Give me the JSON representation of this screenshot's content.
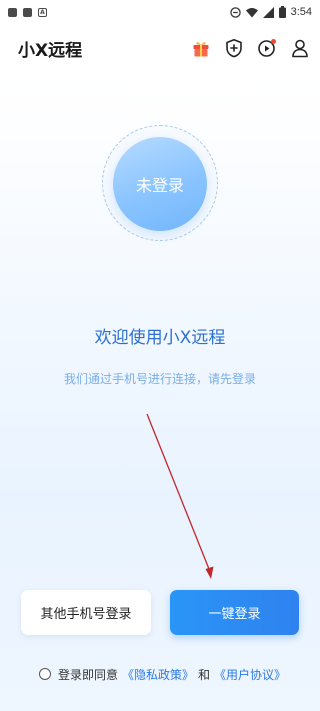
{
  "status_bar": {
    "time": "3:54",
    "notification_icons": [
      "app-square-icon",
      "app-square-icon",
      "a-badge-icon"
    ],
    "status_icons": [
      "do-not-disturb-icon",
      "wifi-icon",
      "cellular-signal-icon",
      "battery-icon"
    ]
  },
  "header": {
    "title": "小X远程",
    "icons": [
      "gift-icon",
      "shield-plus-icon",
      "play-badge-icon",
      "user-icon"
    ]
  },
  "avatar": {
    "status_label": "未登录"
  },
  "welcome": {
    "title": "欢迎使用小X远程",
    "subtitle": "我们通过手机号进行连接，请先登录"
  },
  "buttons": {
    "other_phone_label": "其他手机号登录",
    "one_key_label": "一键登录"
  },
  "agreement": {
    "prefix": "登录即同意",
    "privacy_link": "《隐私政策》",
    "conjunction": "和",
    "terms_link": "《用户协议》",
    "checked": false
  },
  "colors": {
    "accent": "#2f82ef",
    "link": "#2c7be0",
    "welcome_text": "#2c6fd0",
    "annotation_arrow": "#c0282a"
  }
}
